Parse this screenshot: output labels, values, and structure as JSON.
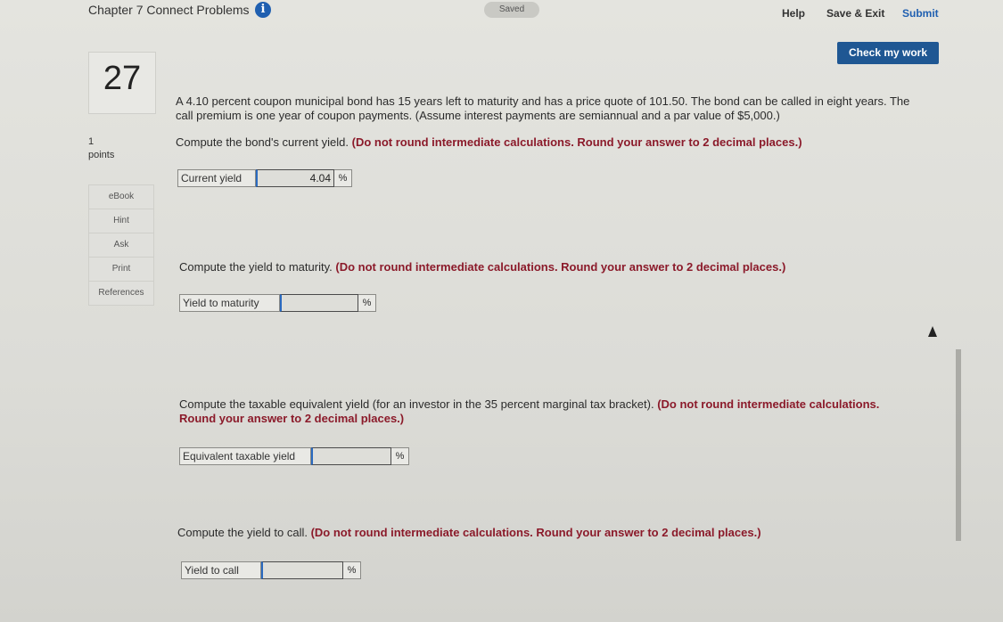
{
  "header": {
    "title": "Chapter 7 Connect Problems",
    "saved_status": "Saved",
    "help": "Help",
    "save_exit": "Save & Exit",
    "submit": "Submit"
  },
  "check_my_work": "Check my work",
  "question": {
    "number": "27",
    "points_value": "1",
    "points_label": "points"
  },
  "side_menu": [
    "eBook",
    "Hint",
    "Ask",
    "Print",
    "References"
  ],
  "problem_text": "A 4.10 percent coupon municipal bond has 15 years left to maturity and has a price quote of 101.50. The bond can be called in eight years. The call premium is one year of coupon payments. (Assume interest payments are semiannual and a par value of $5,000.)",
  "parts": [
    {
      "prompt": "Compute the bond's current yield.",
      "instruction": "(Do not round intermediate calculations. Round your answer to 2 decimal places.)",
      "label": "Current yield",
      "value": "4.04",
      "unit": "%"
    },
    {
      "prompt": "Compute the yield to maturity.",
      "instruction": "(Do not round intermediate calculations. Round your answer to 2 decimal places.)",
      "label": "Yield to maturity",
      "value": "",
      "unit": "%"
    },
    {
      "prompt": "Compute the taxable equivalent yield (for an investor in the 35 percent marginal tax bracket).",
      "instruction": "(Do not round intermediate calculations. Round your answer to 2 decimal places.)",
      "label": "Equivalent taxable yield",
      "value": "",
      "unit": "%"
    },
    {
      "prompt": "Compute the yield to call.",
      "instruction": "(Do not round intermediate calculations. Round your answer to 2 decimal places.)",
      "label": "Yield to call",
      "value": "",
      "unit": "%"
    }
  ]
}
